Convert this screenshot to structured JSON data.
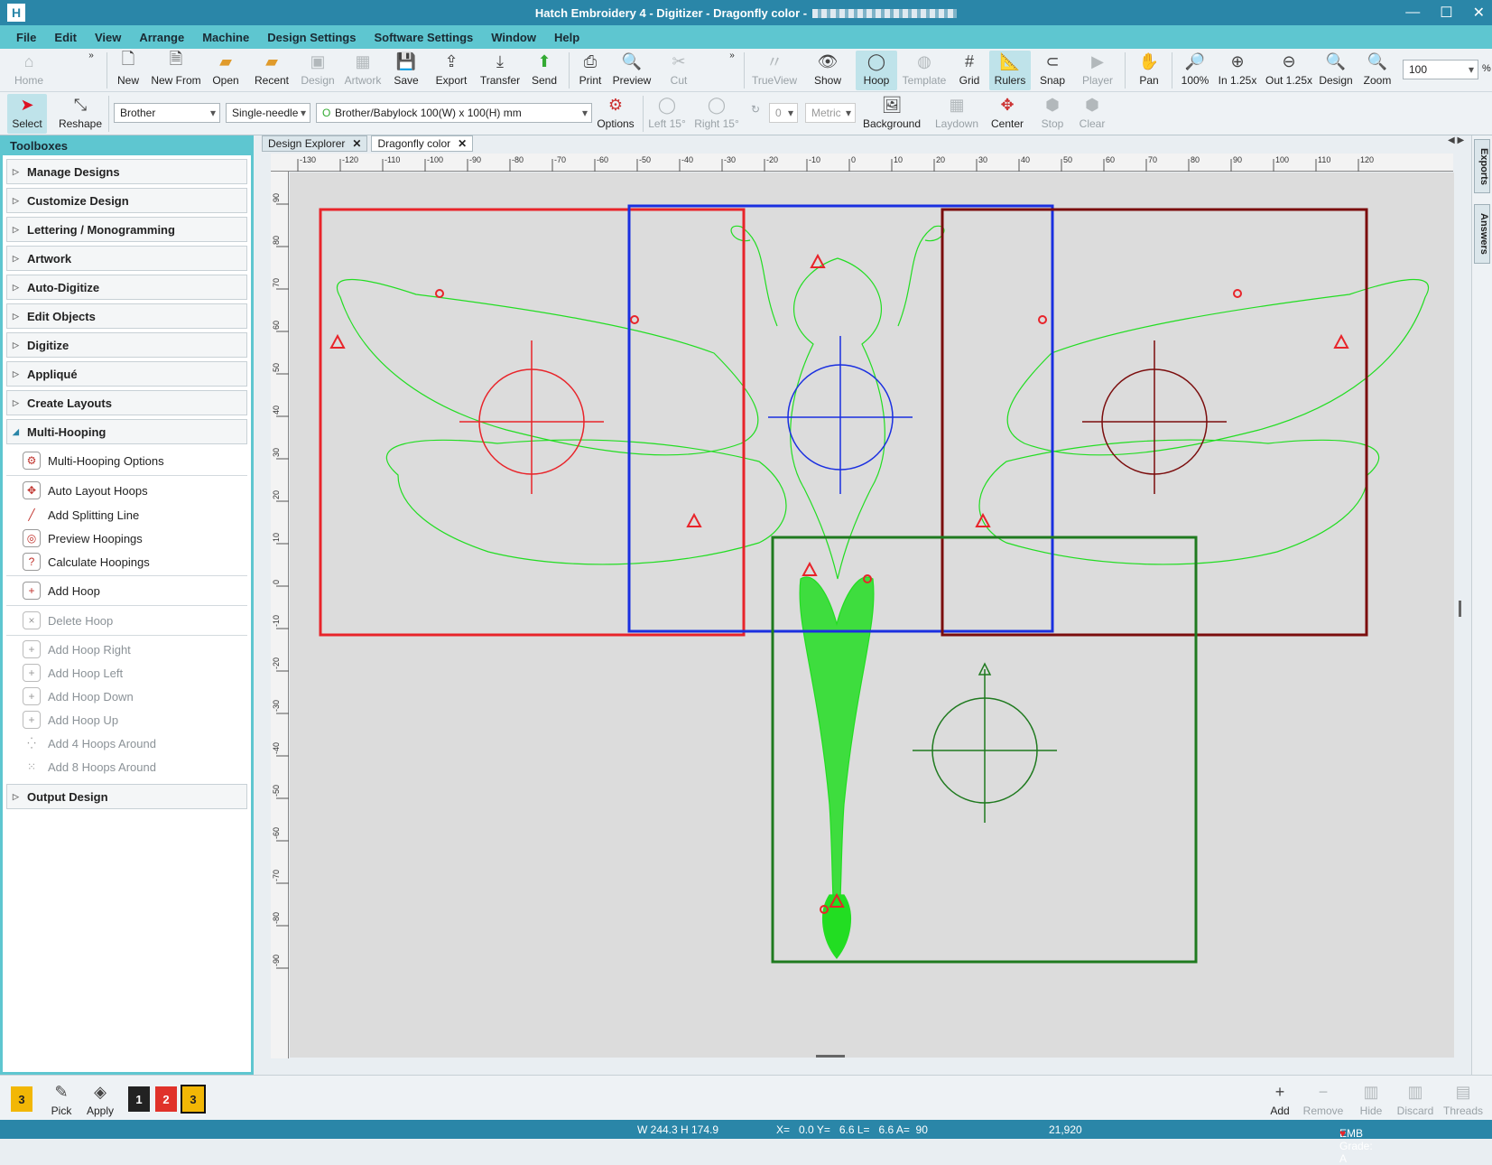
{
  "window": {
    "title": "Hatch Embroidery 4 - Digitizer - Dragonfly color -",
    "app_icon": "H",
    "minimize": "—",
    "maximize": "☐",
    "close": "✕"
  },
  "menu": [
    "File",
    "Edit",
    "View",
    "Arrange",
    "Machine",
    "Design Settings",
    "Software Settings",
    "Window",
    "Help"
  ],
  "toolbar1": {
    "home": "Home",
    "new": "New",
    "new_from": "New From",
    "open": "Open",
    "recent": "Recent",
    "design": "Design",
    "artwork": "Artwork",
    "save": "Save",
    "export": "Export",
    "transfer": "Transfer",
    "send": "Send",
    "print": "Print",
    "preview": "Preview",
    "cut": "Cut",
    "trueview": "TrueView",
    "show": "Show",
    "hoop": "Hoop",
    "template": "Template",
    "grid": "Grid",
    "rulers": "Rulers",
    "snap": "Snap",
    "player": "Player",
    "pan": "Pan",
    "zoom100": "100%",
    "zoom_in": "In 1.25x",
    "zoom_out": "Out 1.25x",
    "zoom_design": "Design",
    "zoom": "Zoom",
    "zoom_value": "100",
    "zoom_unit": "%"
  },
  "toolbar2": {
    "select": "Select",
    "reshape": "Reshape",
    "machine_brand": "Brother",
    "needle": "Single-needle",
    "hoop": "Brother/Babylock 100(W) x 100(H) mm",
    "options": "Options",
    "left15": "Left 15°",
    "right15": "Right 15°",
    "angle_value": "0",
    "units": "Metric",
    "background": "Background",
    "laydown": "Laydown",
    "center": "Center",
    "stop": "Stop",
    "clear": "Clear"
  },
  "toolboxes": {
    "header": "Toolboxes",
    "sections_top": [
      "Manage Designs",
      "Customize Design",
      "Lettering / Monogramming",
      "Artwork",
      "Auto-Digitize",
      "Edit Objects",
      "Digitize",
      "Appliqué",
      "Create Layouts"
    ],
    "open_section": "Multi-Hooping",
    "items": [
      {
        "label": "Multi-Hooping Options",
        "enabled": true
      },
      {
        "label": "Auto Layout Hoops",
        "enabled": true
      },
      {
        "label": "Add Splitting Line",
        "enabled": true
      },
      {
        "label": "Preview Hoopings",
        "enabled": true
      },
      {
        "label": "Calculate Hoopings",
        "enabled": true
      },
      {
        "label": "Add Hoop",
        "enabled": true
      },
      {
        "label": "Delete Hoop",
        "enabled": false
      },
      {
        "label": "Add Hoop Right",
        "enabled": false
      },
      {
        "label": "Add Hoop Left",
        "enabled": false
      },
      {
        "label": "Add Hoop Down",
        "enabled": false
      },
      {
        "label": "Add Hoop Up",
        "enabled": false
      },
      {
        "label": "Add 4 Hoops Around",
        "enabled": false
      },
      {
        "label": "Add 8 Hoops Around",
        "enabled": false
      }
    ],
    "section_bottom": "Output Design"
  },
  "tabs": [
    {
      "label": "Design Explorer",
      "active": false
    },
    {
      "label": "Dragonfly color",
      "active": true
    }
  ],
  "side_tabs": {
    "exports": "Exports",
    "answers": "Answers"
  },
  "ruler_h": [
    "-130",
    "-120",
    "-110",
    "-100",
    "-90",
    "-80",
    "-70",
    "-60",
    "-50",
    "-40",
    "-30",
    "-20",
    "-10",
    "0",
    "10",
    "20",
    "30",
    "40",
    "50",
    "60",
    "70",
    "80",
    "90",
    "100",
    "110",
    "120"
  ],
  "ruler_v": [
    "90",
    "80",
    "70",
    "60",
    "50",
    "40",
    "30",
    "20",
    "10",
    "0",
    "-10",
    "-20",
    "-30",
    "-40",
    "-50",
    "-60",
    "-70",
    "-80",
    "-90"
  ],
  "hoops": [
    {
      "name": "hoop-1",
      "color": "#e8242a"
    },
    {
      "name": "hoop-2",
      "color": "#1a2fe0"
    },
    {
      "name": "hoop-3",
      "color": "#7b0d0d"
    },
    {
      "name": "hoop-4",
      "color": "#1f7a1f"
    }
  ],
  "design_color": "#22dd22",
  "bottom": {
    "current_color": "3",
    "pick": "Pick",
    "apply": "Apply",
    "palette": [
      {
        "num": "1",
        "color": "#222222"
      },
      {
        "num": "2",
        "color": "#e0322a"
      },
      {
        "num": "3",
        "color": "#f2b705"
      }
    ],
    "add": "Add",
    "remove": "Remove",
    "hide": "Hide",
    "discard": "Discard",
    "threads": "Threads"
  },
  "status": {
    "size": "W 244.3 H 174.9",
    "coords": "X=   0.0 Y=   6.6 L=   6.6 A=  90",
    "stitches": "21,920",
    "grade": "EMB Grade: A"
  }
}
